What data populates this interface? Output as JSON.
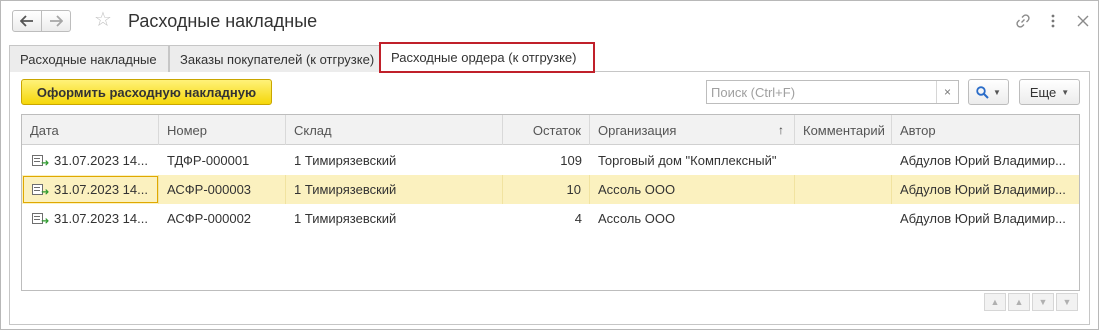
{
  "window": {
    "title": "Расходные накладные",
    "back_icon": "arrow-left",
    "forward_icon": "arrow-right",
    "favorite_icon": "star-outline"
  },
  "tabs": [
    {
      "label": "Расходные накладные",
      "active": false
    },
    {
      "label": "Заказы покупателей (к отгрузке)",
      "active": false
    },
    {
      "label": "Расходные ордера (к отгрузке)",
      "active": true
    }
  ],
  "toolbar": {
    "primary_label": "Оформить расходную накладную",
    "search_placeholder": "Поиск (Ctrl+F)",
    "search_value": "",
    "clear_glyph": "×",
    "more_label": "Еще"
  },
  "table": {
    "columns": [
      "Дата",
      "Номер",
      "Склад",
      "Остаток",
      "Организация",
      "Комментарий",
      "Автор"
    ],
    "sort_column": "Организация",
    "sort_glyph": "↑",
    "rows": [
      {
        "date": "31.07.2023 14...",
        "number": "ТДФР-000001",
        "warehouse": "1 Тимирязевский",
        "balance": "109",
        "org": "Торговый дом \"Комплексный\"",
        "comment": "",
        "author": "Абдулов Юрий Владимир...",
        "selected": false
      },
      {
        "date": "31.07.2023 14...",
        "number": "АСФР-000003",
        "warehouse": "1 Тимирязевский",
        "balance": "10",
        "org": "Ассоль ООО",
        "comment": "",
        "author": "Абдулов Юрий Владимир...",
        "selected": true
      },
      {
        "date": "31.07.2023 14...",
        "number": "АСФР-000002",
        "warehouse": "1 Тимирязевский",
        "balance": "4",
        "org": "Ассоль ООО",
        "comment": "",
        "author": "Абдулов Юрий Владимир...",
        "selected": false
      }
    ]
  },
  "colors": {
    "accent_yellow": "#f5d70a",
    "selected_row": "#fbf1bf",
    "active_tab_border": "#c0202a",
    "search_icon": "#2a6cc8"
  }
}
